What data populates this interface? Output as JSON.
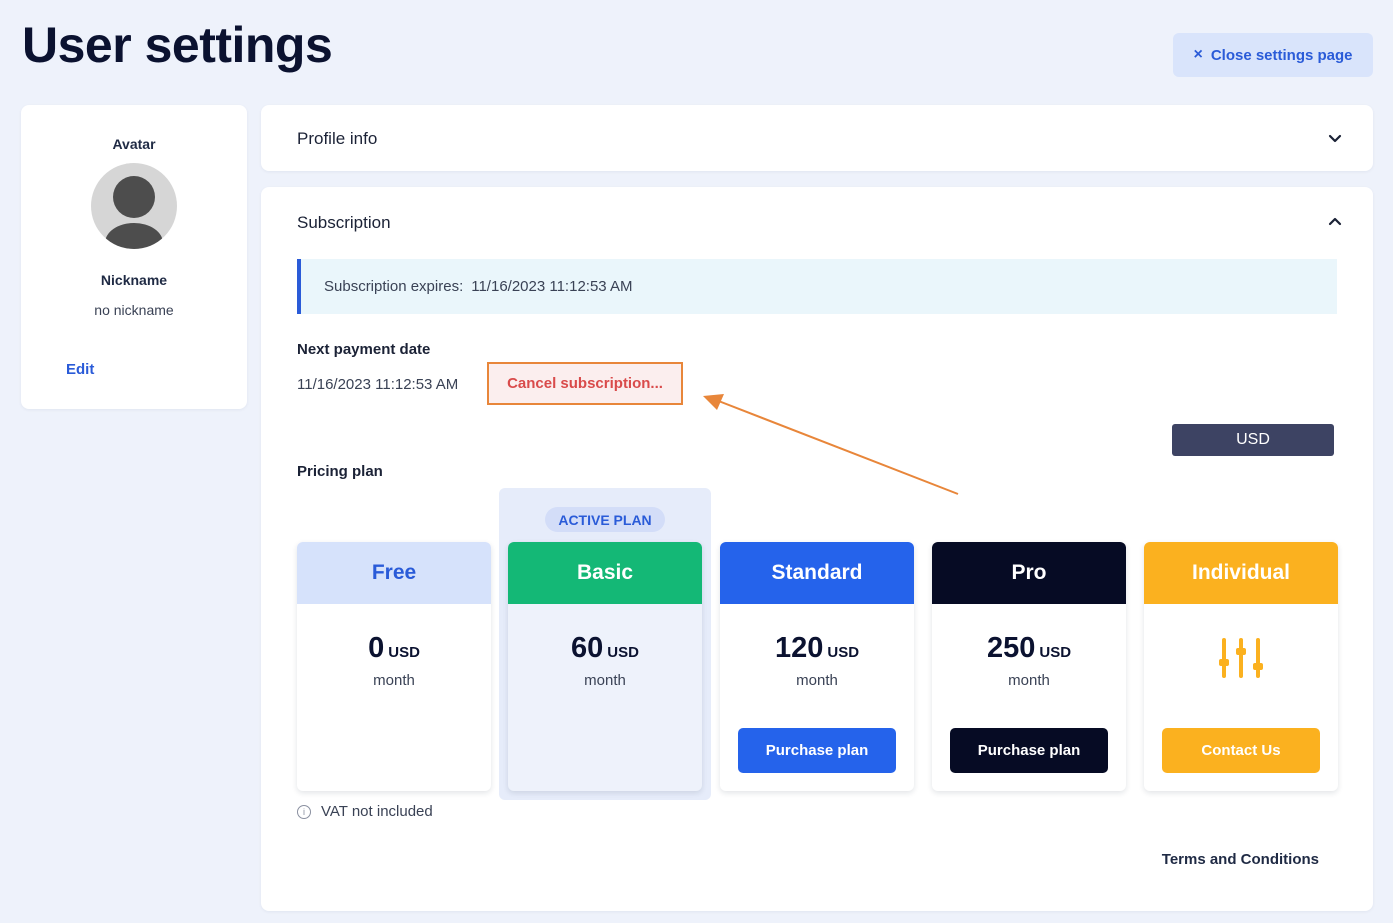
{
  "header": {
    "title": "User settings",
    "close_label": "Close settings page",
    "close_icon": "×"
  },
  "profile": {
    "avatar_label": "Avatar",
    "nickname_label": "Nickname",
    "nickname_value": "no nickname",
    "edit_label": "Edit"
  },
  "sections": {
    "profile_info": "Profile info",
    "subscription": "Subscription"
  },
  "subscription": {
    "expires_label": "Subscription expires:",
    "expires_value": "11/16/2023 11:12:53 AM",
    "next_payment_label": "Next payment date",
    "next_payment_value": "11/16/2023 11:12:53 AM",
    "cancel_label": "Cancel subscription...",
    "currency": "USD",
    "pricing_label": "Pricing plan",
    "active_badge": "ACTIVE PLAN",
    "vat_note": "VAT not included",
    "terms_label": "Terms and Conditions"
  },
  "plans": [
    {
      "name": "Free",
      "price": "0",
      "currency": "USD",
      "period": "month",
      "head_bg": "#d6e2fb",
      "head_color": "#2a5bd8"
    },
    {
      "name": "Basic",
      "price": "60",
      "currency": "USD",
      "period": "month",
      "head_bg": "#14b876",
      "head_color": "#ffffff"
    },
    {
      "name": "Standard",
      "price": "120",
      "currency": "USD",
      "period": "month",
      "head_bg": "#2563eb",
      "head_color": "#ffffff",
      "button": "Purchase plan",
      "button_bg": "#2563eb"
    },
    {
      "name": "Pro",
      "price": "250",
      "currency": "USD",
      "period": "month",
      "head_bg": "#060b24",
      "head_color": "#ffffff",
      "button": "Purchase plan",
      "button_bg": "#060b24"
    },
    {
      "name": "Individual",
      "head_bg": "#fbb11f",
      "head_color": "#ffffff",
      "button": "Contact Us",
      "button_bg": "#fbb11f",
      "icon": "sliders-icon"
    }
  ],
  "colors": {
    "accent": "#2a5bd8",
    "annotation": "#e8863a"
  }
}
